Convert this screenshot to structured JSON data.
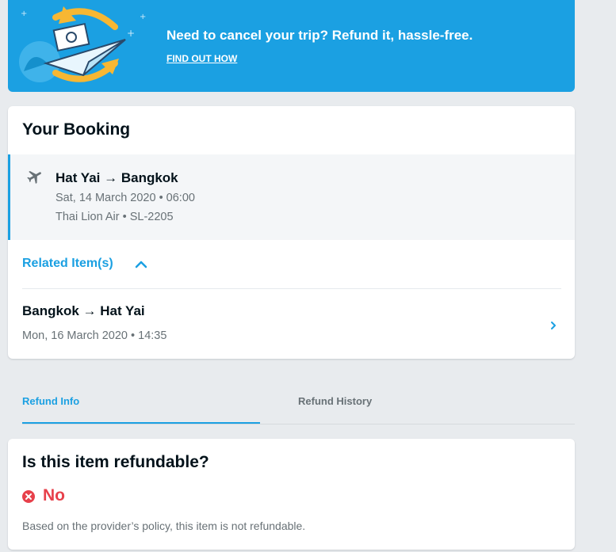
{
  "banner": {
    "title": "Need to cancel your trip? Refund it, hassle-free.",
    "link": "FIND OUT HOW"
  },
  "booking": {
    "title": "Your Booking",
    "flight": {
      "route": "Hat Yai → Bangkok",
      "date": "Sat, 14 March 2020 • 06:00",
      "airline": "Thai Lion Air • SL-2205"
    },
    "related_label": "Related Item(s)",
    "related_items": [
      {
        "route": "Bangkok → Hat Yai",
        "date": "Mon, 16 March 2020 • 14:35"
      }
    ]
  },
  "tabs": [
    {
      "label": "Refund Info",
      "active": true
    },
    {
      "label": "Refund History",
      "active": false
    }
  ],
  "refund": {
    "question": "Is this item refundable?",
    "answer": "No",
    "description": "Based on the provider’s policy, this item is not refundable."
  },
  "colors": {
    "accent": "#1ba0e2",
    "danger": "#e7414b",
    "muted": "#687176"
  },
  "icons": [
    "refund-illustration",
    "plane-icon",
    "chevron-up-icon",
    "chevron-right-icon",
    "no-icon"
  ]
}
